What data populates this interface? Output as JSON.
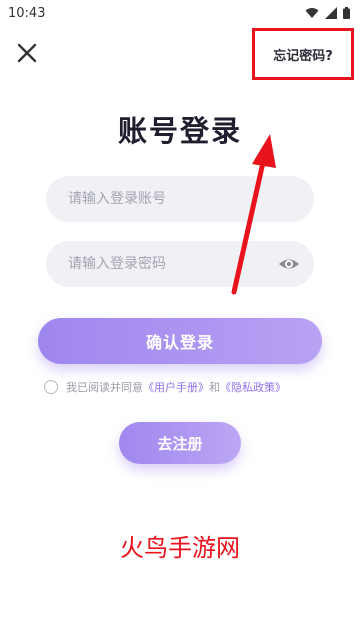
{
  "status_bar": {
    "time": "10:43"
  },
  "header": {
    "forgot_password": "忘记密码?"
  },
  "title": "账号登录",
  "account_field": {
    "placeholder": "请输入登录账号",
    "value": ""
  },
  "password_field": {
    "placeholder": "请输入登录密码",
    "value": ""
  },
  "login_button": "确认登录",
  "agreement": {
    "checked": false,
    "prefix": "我已阅读并同意",
    "user_manual": "《用户手册》",
    "and": "和",
    "privacy_policy": "《隐私政策》"
  },
  "register_button": "去注册",
  "watermark": "火鸟手游网",
  "colors": {
    "accent": "#9e86ef",
    "highlight_red": "#e8131c",
    "input_bg": "#f0f1f5"
  },
  "icons": [
    "wifi-icon",
    "signal-icon",
    "battery-icon",
    "close-icon",
    "eye-icon",
    "annotation-arrow"
  ]
}
